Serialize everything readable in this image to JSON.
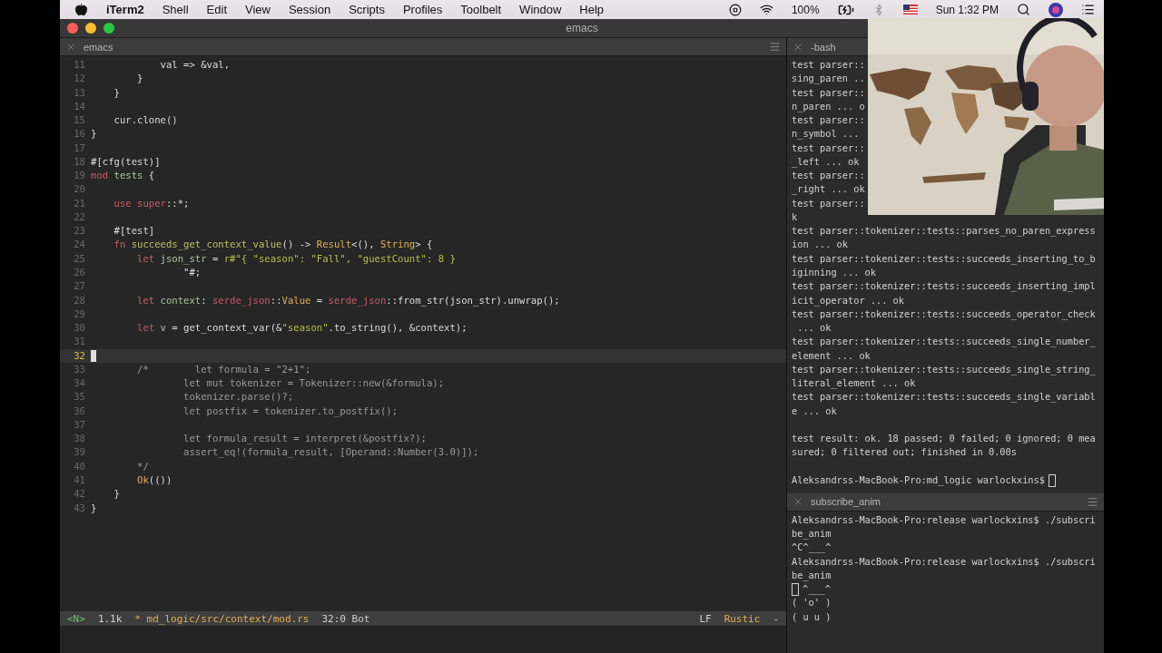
{
  "menubar": {
    "app": "iTerm2",
    "items": [
      "Shell",
      "Edit",
      "View",
      "Session",
      "Scripts",
      "Profiles",
      "Toolbelt",
      "Window",
      "Help"
    ],
    "battery": "100%",
    "clock": "Sun 1:32 PM"
  },
  "window": {
    "title": "emacs"
  },
  "editor": {
    "tab": "emacs",
    "lines": [
      {
        "num": "11",
        "current": false,
        "segments": [
          {
            "text": "            val => &val,",
            "kind": "plain"
          }
        ]
      },
      {
        "num": "12",
        "current": false,
        "segments": [
          {
            "text": "        }",
            "kind": "plain"
          }
        ]
      },
      {
        "num": "13",
        "current": false,
        "segments": [
          {
            "text": "    }",
            "kind": "plain"
          }
        ]
      },
      {
        "num": "14",
        "current": false
      },
      {
        "num": "15",
        "current": false,
        "segments": [
          {
            "text": "    cur.clone()",
            "kind": "plain"
          }
        ]
      },
      {
        "num": "16",
        "current": false,
        "segments": [
          {
            "text": "}",
            "kind": "plain"
          }
        ]
      },
      {
        "num": "17",
        "current": false
      },
      {
        "num": "18",
        "current": false,
        "segments": [
          {
            "text": "#[cfg(test)]",
            "kind": "plain"
          }
        ]
      },
      {
        "num": "19",
        "current": false,
        "segments": [
          {
            "text": "mod",
            "kind": "keyword"
          },
          {
            "text": " tests",
            "kind": "variable"
          },
          {
            "text": " {",
            "kind": "plain"
          }
        ]
      },
      {
        "num": "20",
        "current": false
      },
      {
        "num": "21",
        "current": false,
        "segments": [
          {
            "text": "    use",
            "kind": "keyword"
          },
          {
            "text": " super",
            "kind": "keyword"
          },
          {
            "text": "::*;",
            "kind": "plain"
          }
        ]
      },
      {
        "num": "22",
        "current": false
      },
      {
        "num": "23",
        "current": false,
        "segments": [
          {
            "text": "    #[test]",
            "kind": "plain"
          }
        ]
      },
      {
        "num": "24",
        "current": false,
        "segments": [
          {
            "text": "    fn",
            "kind": "keyword"
          },
          {
            "text": " succeeds_get_context_value",
            "kind": "function"
          },
          {
            "text": "() -> ",
            "kind": "plain"
          },
          {
            "text": "Result",
            "kind": "type"
          },
          {
            "text": "<(), ",
            "kind": "plain"
          },
          {
            "text": "String",
            "kind": "type"
          },
          {
            "text": "> {",
            "kind": "plain"
          }
        ]
      },
      {
        "num": "25",
        "current": false,
        "segments": [
          {
            "text": "        let",
            "kind": "keyword"
          },
          {
            "text": " json_str",
            "kind": "variable"
          },
          {
            "text": " = ",
            "kind": "plain"
          },
          {
            "text": "r#\"{ \"season\": \"Fall\", \"guestCount\": 8 }",
            "kind": "string"
          }
        ]
      },
      {
        "num": "26",
        "current": false,
        "segments": [
          {
            "text": "                \"#;",
            "kind": "plain"
          }
        ]
      },
      {
        "num": "27",
        "current": false
      },
      {
        "num": "28",
        "current": false,
        "segments": [
          {
            "text": "        let",
            "kind": "keyword"
          },
          {
            "text": " context",
            "kind": "variable"
          },
          {
            "text": ": ",
            "kind": "plain"
          },
          {
            "text": "serde_json",
            "kind": "keyword"
          },
          {
            "text": "::",
            "kind": "plain"
          },
          {
            "text": "Value",
            "kind": "type"
          },
          {
            "text": " = ",
            "kind": "plain"
          },
          {
            "text": "serde_json",
            "kind": "keyword"
          },
          {
            "text": "::from_str(json_str).unwrap();",
            "kind": "plain"
          }
        ]
      },
      {
        "num": "29",
        "current": false
      },
      {
        "num": "30",
        "current": false,
        "segments": [
          {
            "text": "        let",
            "kind": "keyword"
          },
          {
            "text": " v",
            "kind": "variable"
          },
          {
            "text": " = get_context_var(&",
            "kind": "plain"
          },
          {
            "text": "\"season\"",
            "kind": "string"
          },
          {
            "text": ".to_string(), &context);",
            "kind": "plain"
          }
        ]
      },
      {
        "num": "31",
        "current": false
      },
      {
        "num": "32",
        "current": true
      },
      {
        "num": "33",
        "current": false,
        "segments": [
          {
            "text": "        /*        let formula = \"2+1\";",
            "kind": "comment"
          }
        ]
      },
      {
        "num": "34",
        "current": false,
        "segments": [
          {
            "text": "                let mut tokenizer = Tokenizer::new(&formula);",
            "kind": "comment"
          }
        ]
      },
      {
        "num": "35",
        "current": false,
        "segments": [
          {
            "text": "                tokenizer.parse()?;",
            "kind": "comment"
          }
        ]
      },
      {
        "num": "36",
        "current": false,
        "segments": [
          {
            "text": "                let postfix = tokenizer.to_postfix();",
            "kind": "comment"
          }
        ]
      },
      {
        "num": "37",
        "current": false
      },
      {
        "num": "38",
        "current": false,
        "segments": [
          {
            "text": "                let formula_result = interpret(&postfix?);",
            "kind": "comment"
          }
        ]
      },
      {
        "num": "39",
        "current": false,
        "segments": [
          {
            "text": "                assert_eq!(formula_result, [Operand::Number(3.0)]);",
            "kind": "comment"
          }
        ]
      },
      {
        "num": "40",
        "current": false,
        "segments": [
          {
            "text": "        */",
            "kind": "comment"
          }
        ]
      },
      {
        "num": "41",
        "current": false,
        "segments": [
          {
            "text": "        Ok",
            "kind": "type"
          },
          {
            "text": "(())",
            "kind": "plain"
          }
        ]
      },
      {
        "num": "42",
        "current": false,
        "segments": [
          {
            "text": "    }",
            "kind": "plain"
          }
        ]
      },
      {
        "num": "43",
        "current": false,
        "segments": [
          {
            "text": "}",
            "kind": "plain"
          }
        ]
      }
    ],
    "modeline": {
      "mode": "<N>",
      "size": "1.1k",
      "file": "* md_logic/src/context/mod.rs",
      "position": "32:0 Bot",
      "eol": "LF",
      "major_mode": "Rustic",
      "flag": "-"
    }
  },
  "bash": {
    "tab": "-bash",
    "output": [
      "test parser::",
      "sing_paren ..",
      "test parser::",
      "n_paren ... o",
      "test parser::",
      "n_symbol ...",
      "test parser::",
      "_left ... ok",
      "test parser::",
      "_right ... ok",
      "test parser::",
      "k",
      "test parser::tokenizer::tests::parses_no_paren_express",
      "ion ... ok",
      "test parser::tokenizer::tests::succeeds_inserting_to_b",
      "iginning ... ok",
      "test parser::tokenizer::tests::succeeds_inserting_impl",
      "icit_operator ... ok",
      "test parser::tokenizer::tests::succeeds_operator_check",
      " ... ok",
      "test parser::tokenizer::tests::succeeds_single_number_",
      "element ... ok",
      "test parser::tokenizer::tests::succeeds_single_string_",
      "literal_element ... ok",
      "test parser::tokenizer::tests::succeeds_single_variabl",
      "e ... ok"
    ],
    "summary": [
      "test result: ok. 18 passed; 0 failed; 0 ignored; 0 mea",
      "sured; 0 filtered out; finished in 0.00s"
    ],
    "prompt": "Aleksandrss-MacBook-Pro:md_logic warlockxins$"
  },
  "subscribe": {
    "tab": "subscribe_anim",
    "lines": [
      {
        "text": "Aleksandrss-MacBook-Pro:release warlockxins$ ./subscri",
        "cursor": false
      },
      {
        "text": "be_anim",
        "cursor": false
      },
      {
        "text": "^C^___^",
        "cursor": false
      },
      {
        "text": "Aleksandrss-MacBook-Pro:release warlockxins$ ./subscri",
        "cursor": false
      },
      {
        "text": "be_anim",
        "cursor": false
      },
      {
        "text": "^___^",
        "cursor": true
      },
      {
        "text": "( 'o' )",
        "cursor": false
      },
      {
        "text": "( u u )",
        "cursor": false
      }
    ]
  }
}
